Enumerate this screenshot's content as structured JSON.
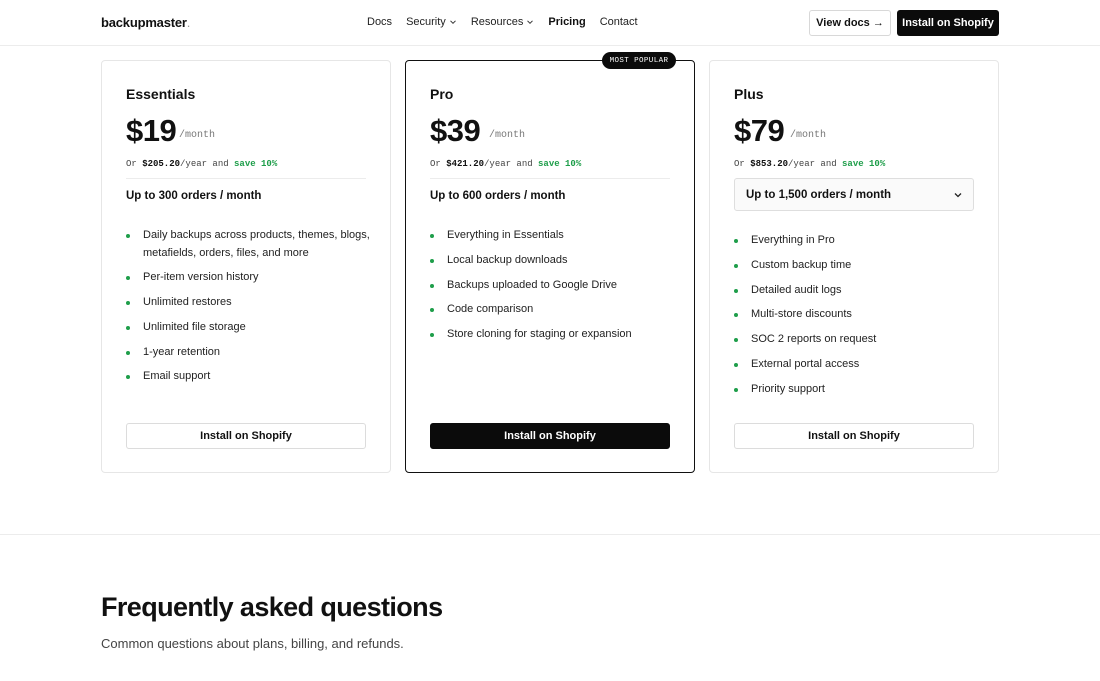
{
  "header": {
    "logo_text": "backupmaster",
    "logo_dot": ".",
    "nav": [
      {
        "label": "Docs",
        "has_menu": false,
        "active": false
      },
      {
        "label": "Security",
        "has_menu": true,
        "active": false
      },
      {
        "label": "Resources",
        "has_menu": true,
        "active": false
      },
      {
        "label": "Pricing",
        "has_menu": false,
        "active": true
      },
      {
        "label": "Contact",
        "has_menu": false,
        "active": false
      }
    ],
    "view_docs_label": "View docs →",
    "install_label": "Install on Shopify"
  },
  "plans": [
    {
      "name": "Essentials",
      "price": "$19",
      "period": "/month",
      "yearly_prefix": "Or ",
      "yearly_price": "$205.20",
      "yearly_mid": "/year and ",
      "yearly_save": "save 10%",
      "orders": "Up to 300 orders / month",
      "features": [
        "Daily backups across products, themes, blogs, metafields, orders, files, and more",
        "Per-item version history",
        "Unlimited restores",
        "Unlimited file storage",
        "1-year retention",
        "Email support"
      ],
      "cta": "Install on Shopify"
    },
    {
      "name": "Pro",
      "badge": "MOST POPULAR",
      "price": "$39",
      "period": "/month",
      "yearly_prefix": "Or ",
      "yearly_price": "$421.20",
      "yearly_mid": "/year and ",
      "yearly_save": "save 10%",
      "orders": "Up to 600 orders / month",
      "features": [
        "Everything in Essentials",
        "Local backup downloads",
        "Backups uploaded to Google Drive",
        "Code comparison",
        "Store cloning for staging or expansion"
      ],
      "cta": "Install on Shopify"
    },
    {
      "name": "Plus",
      "price": "$79",
      "period": "/month",
      "yearly_prefix": "Or ",
      "yearly_price": "$853.20",
      "yearly_mid": "/year and ",
      "yearly_save": "save 10%",
      "orders": "Up to 1,500 orders / month",
      "features": [
        "Everything in Pro",
        "Custom backup time",
        "Detailed audit logs",
        "Multi-store discounts",
        "SOC 2 reports on request",
        "External portal access",
        "Priority support"
      ],
      "cta": "Install on Shopify"
    }
  ],
  "faq": {
    "title": "Frequently asked questions",
    "subtitle": "Common questions about plans, billing, and refunds."
  },
  "colors": {
    "accent_green": "#1e9e4a",
    "primary_black": "#0b0b0b"
  }
}
